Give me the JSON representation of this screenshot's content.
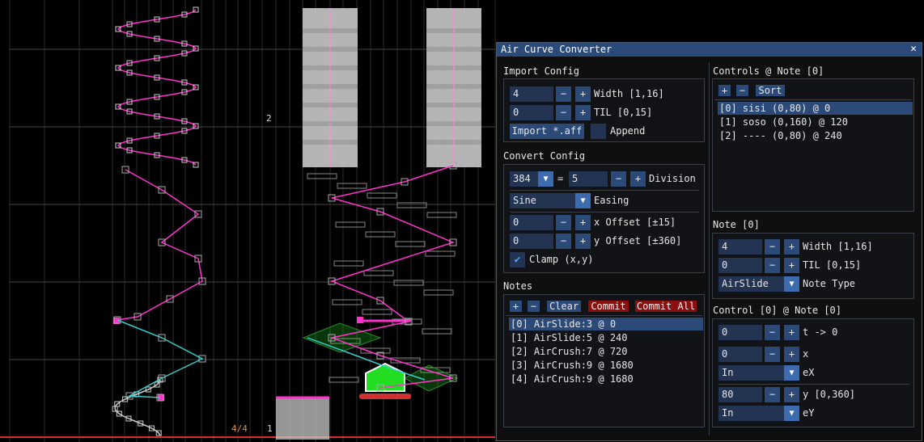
{
  "editor": {
    "measure_label": "2",
    "beat_label": "4/4",
    "bar_label": "1"
  },
  "window": {
    "title": "Air Curve Converter",
    "close_glyph": "✕",
    "import_config": {
      "header": "Import Config",
      "width_value": "4",
      "width_label": "Width [1,16]",
      "til_value": "0",
      "til_label": "TIL [0,15]",
      "import_button": "Import *.aff",
      "append_label": "Append",
      "append_checked": false
    },
    "convert_config": {
      "header": "Convert Config",
      "division_base": "384",
      "equals": "=",
      "division_value": "5",
      "division_label": "Division",
      "easing_value": "Sine",
      "easing_label": "Easing",
      "x_offset_value": "0",
      "x_offset_label": "x Offset [±15]",
      "y_offset_value": "0",
      "y_offset_label": "y Offset [±360]",
      "clamp_label": "Clamp (x,y)",
      "clamp_checked": true
    },
    "notes": {
      "header": "Notes",
      "add": "+",
      "remove": "−",
      "clear": "Clear",
      "commit": "Commit",
      "commit_all": "Commit All",
      "items": [
        "[0] AirSlide:3 @ 0",
        "[1] AirSlide:5 @ 240",
        "[2] AirCrush:7 @ 720",
        "[3] AirCrush:9 @ 1680",
        "[4] AirCrush:9 @ 1680"
      ]
    },
    "controls": {
      "header": "Controls @ Note [0]",
      "add": "+",
      "remove": "−",
      "sort": "Sort",
      "items": [
        "[0] sisi (0,80) @ 0",
        "[1] soso (0,160) @ 120",
        "[2] ---- (0,80) @ 240"
      ]
    },
    "note": {
      "header": "Note [0]",
      "width_value": "4",
      "width_label": "Width [1,16]",
      "til_value": "0",
      "til_label": "TIL [0,15]",
      "type_value": "AirSlide",
      "type_label": "Note Type"
    },
    "control": {
      "header": "Control [0] @ Note [0]",
      "t_value": "0",
      "t_label": "t -> 0",
      "x_value": "0",
      "x_label": "x",
      "ex_value": "In",
      "ex_label": "eX",
      "y_value": "80",
      "y_label": "y [0,360]",
      "ey_value": "In",
      "ey_label": "eY"
    },
    "minus": "−",
    "plus": "+",
    "arrow": "▼",
    "check": "✔"
  },
  "colors": {
    "accent": "#2b4a78",
    "danger": "#8a1010",
    "curve_pink": "#ff33cc",
    "curve_cyan": "#33cccc",
    "air_green": "#22dd22"
  }
}
